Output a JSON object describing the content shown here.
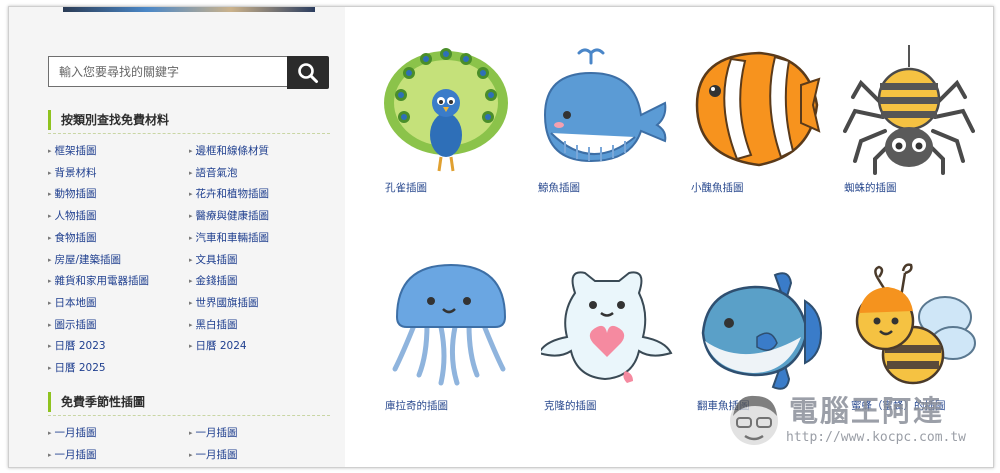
{
  "search": {
    "placeholder": "輸入您要尋找的關鍵字",
    "button_icon": "search-icon"
  },
  "categories": {
    "title": "按類別查找免費材料",
    "left": [
      "框架插圖",
      "背景材料",
      "動物插圖",
      "人物插圖",
      "食物插圖",
      "房屋/建築插圖",
      "雜貨和家用電器插圖",
      "日本地圖",
      "圖示插圖",
      "日曆 2023",
      "日曆 2025"
    ],
    "right": [
      "邊框和線條材質",
      "語音氣泡",
      "花卉和植物插圖",
      "醫療與健康插圖",
      "汽車和車輛插圖",
      "文具插圖",
      "金錢插圖",
      "世界國旗插圖",
      "黑白插圖",
      "日曆 2024"
    ]
  },
  "seasonal": {
    "title": "免費季節性插圖",
    "left": [
      "一月插圖",
      "一月插圖"
    ],
    "right": [
      "一月插圖",
      "一月插圖"
    ]
  },
  "gallery": [
    {
      "caption": "孔雀插圖",
      "icon": "peacock-icon"
    },
    {
      "caption": "鯨魚插圖",
      "icon": "whale-icon"
    },
    {
      "caption": "小醜魚插圖",
      "icon": "clownfish-icon"
    },
    {
      "caption": "蜘蛛的插圖",
      "icon": "spider-icon"
    },
    {
      "caption": "庫拉奇的插圖",
      "icon": "jellyfish-icon"
    },
    {
      "caption": "克隆的插圖",
      "icon": "clione-icon"
    },
    {
      "caption": "翻車魚插圖",
      "icon": "sunfish-icon"
    },
    {
      "caption": "蜜蜂（蜜蜂）的插圖",
      "icon": "bee-icon"
    }
  ],
  "watermark": {
    "title": "電腦王阿達",
    "url": "http://www.kocpc.com.tw"
  },
  "colors": {
    "accent": "#8fc31f",
    "link": "#1f3f8f",
    "sidebar_bg": "#f5f5f5",
    "button": "#2b2b2b"
  }
}
